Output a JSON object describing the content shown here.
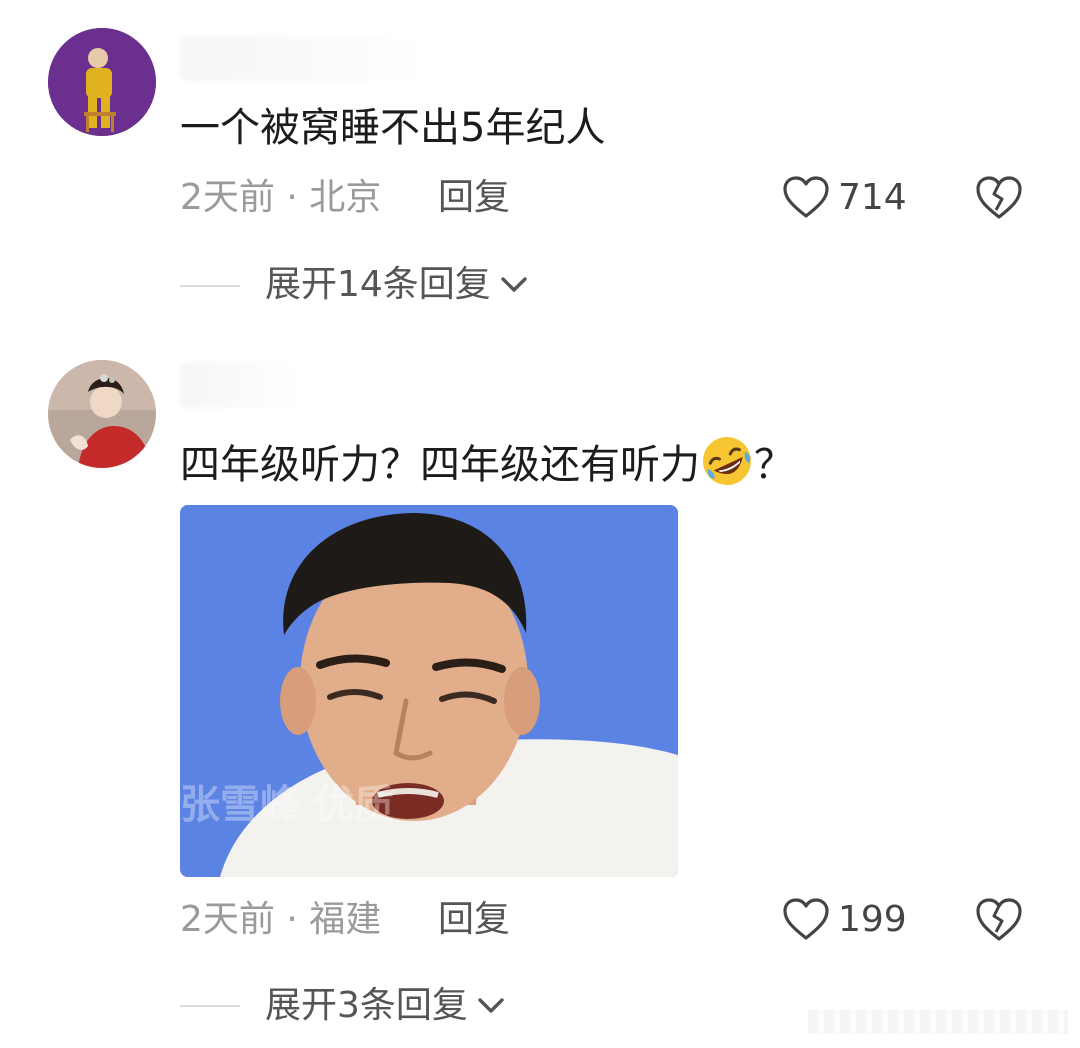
{
  "comments": [
    {
      "text": "一个被窝睡不出5年纪人",
      "time_location": "2天前 · 北京",
      "reply_label": "回复",
      "like_count": "714",
      "expand_label": "展开14条回复"
    },
    {
      "text": "四年级听力？四年级还有听力",
      "text_suffix": "？",
      "emoji": "rolling-on-floor-laughing-emoji",
      "image_watermark": "张雪峰 优质",
      "time_location": "2天前 · 福建",
      "reply_label": "回复",
      "like_count": "199",
      "expand_label": "展开3条回复"
    }
  ],
  "colors": {
    "meme_background": "#5b83e4",
    "meta_text": "#9a9a9a",
    "avatar1_bg": "#5a2a7d"
  },
  "icons": [
    "heart-icon",
    "broken-heart-icon",
    "chevron-down-icon"
  ]
}
